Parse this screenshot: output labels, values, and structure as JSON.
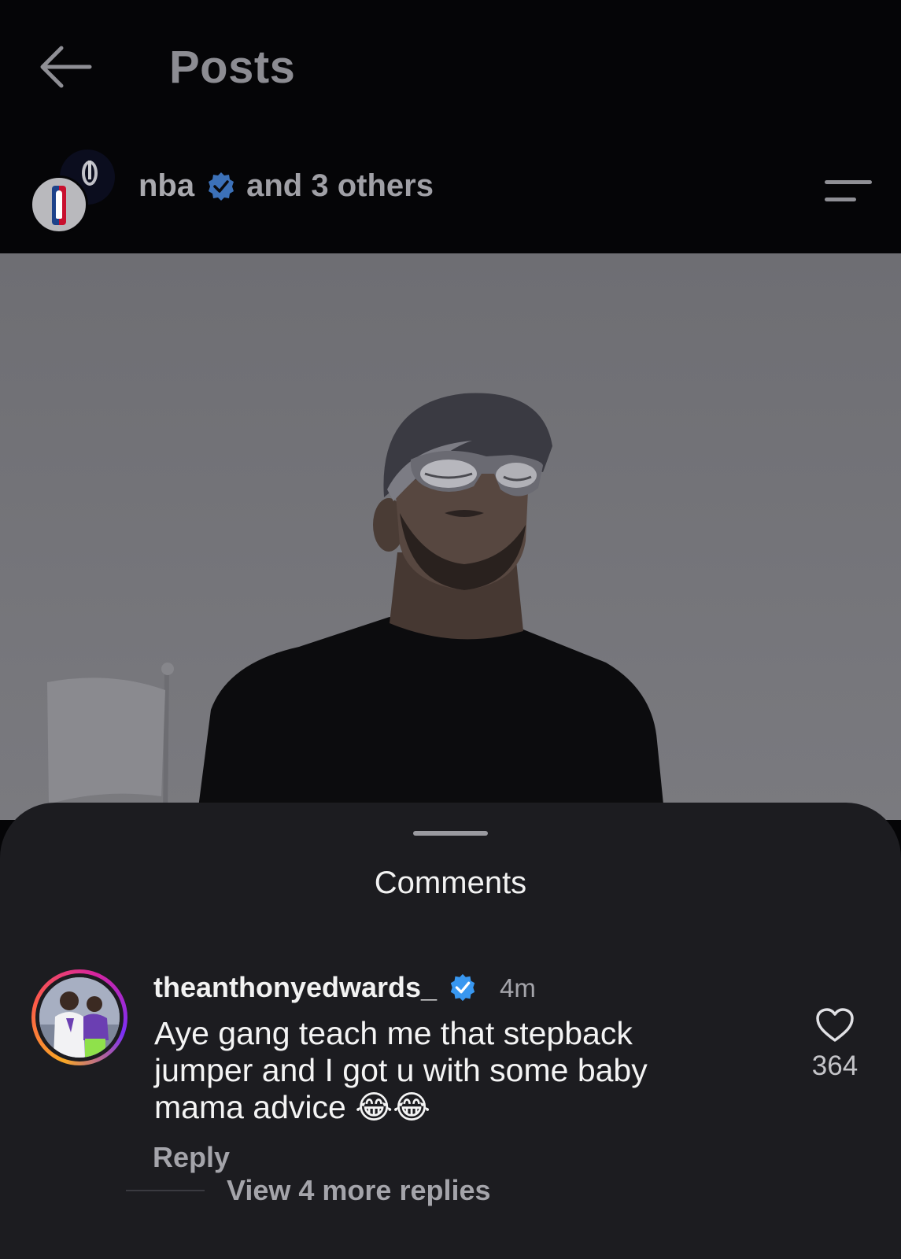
{
  "header": {
    "title": "Posts",
    "back_icon": "arrow-left-icon",
    "menu_icon": "menu-lines-icon"
  },
  "post": {
    "author": "nba",
    "collaborators_text": "and 3 others",
    "verified_color": "#3897f0"
  },
  "comments_sheet": {
    "title": "Comments",
    "comments": [
      {
        "username": "theanthonyedwards_",
        "time": "4m",
        "text": "Aye gang teach me that stepback jumper and I got u with some baby mama advice 😂😂",
        "reply_label": "Reply",
        "likes": "364",
        "view_more_label": "View 4 more replies"
      }
    ]
  },
  "colors": {
    "background": "#050507",
    "sheet": "#1c1c20",
    "muted_text": "#a4a4aa"
  }
}
